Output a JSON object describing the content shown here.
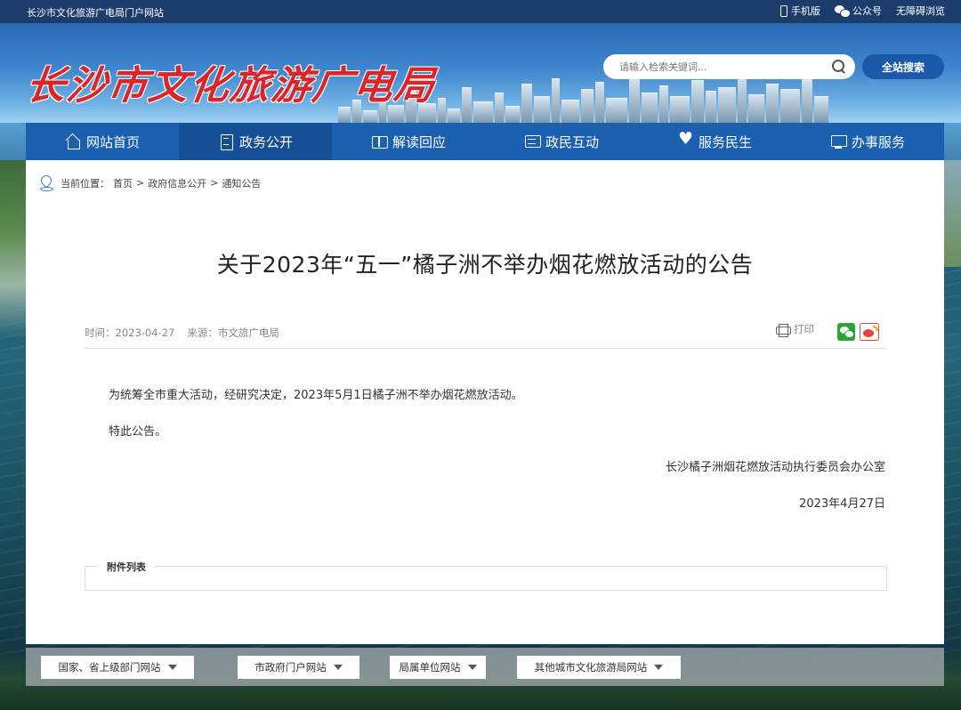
{
  "topbar": {
    "site_title": "长沙市文化旅游广电局门户网站",
    "mobile_label": "手机版",
    "wechat_label": "公众号",
    "accessibility_label": "无障碍浏览"
  },
  "header": {
    "logo_text": "长沙市文化旅游广电局",
    "search_placeholder": "请输入检索关键词...",
    "search_button": "全站搜索"
  },
  "nav": {
    "items": [
      {
        "label": "网站首页",
        "icon": "home-icon"
      },
      {
        "label": "政务公开",
        "icon": "document-icon",
        "active": true
      },
      {
        "label": "解读回应",
        "icon": "book-icon"
      },
      {
        "label": "政民互动",
        "icon": "chat-icon"
      },
      {
        "label": "服务民生",
        "icon": "heart-hand-icon"
      },
      {
        "label": "办事服务",
        "icon": "monitor-icon"
      }
    ]
  },
  "breadcrumb": {
    "prefix": "当前位置：",
    "items": [
      "首页",
      "政府信息公开",
      "通知公告"
    ],
    "separator": ">"
  },
  "article": {
    "title": "关于2023年“五一”橘子洲不举办烟花燃放活动的公告",
    "date": "时间：2023-04-27",
    "source": "来源：市文旅广电局",
    "print_label": "打印",
    "body": [
      "为统筹全市重大活动，经研究决定，2023年5月1日橘子洲不举办烟花燃放活动。",
      "特此公告。"
    ],
    "signature": "长沙橘子洲烟花燃放活动执行委员会办公室",
    "sign_date": "2023年4月27日",
    "attachments_label": "附件列表"
  },
  "footer": {
    "links": [
      "国家、省上级部门网站",
      "市政府门户网站",
      "局属单位网站",
      "其他城市文化旅游局网站"
    ]
  },
  "colors": {
    "nav_bg": "#1a5fb0",
    "nav_active": "#154f96",
    "topbar_bg": "#1c3d6b",
    "logo_red": "#d9262b",
    "search_btn": "#1b59a9"
  }
}
